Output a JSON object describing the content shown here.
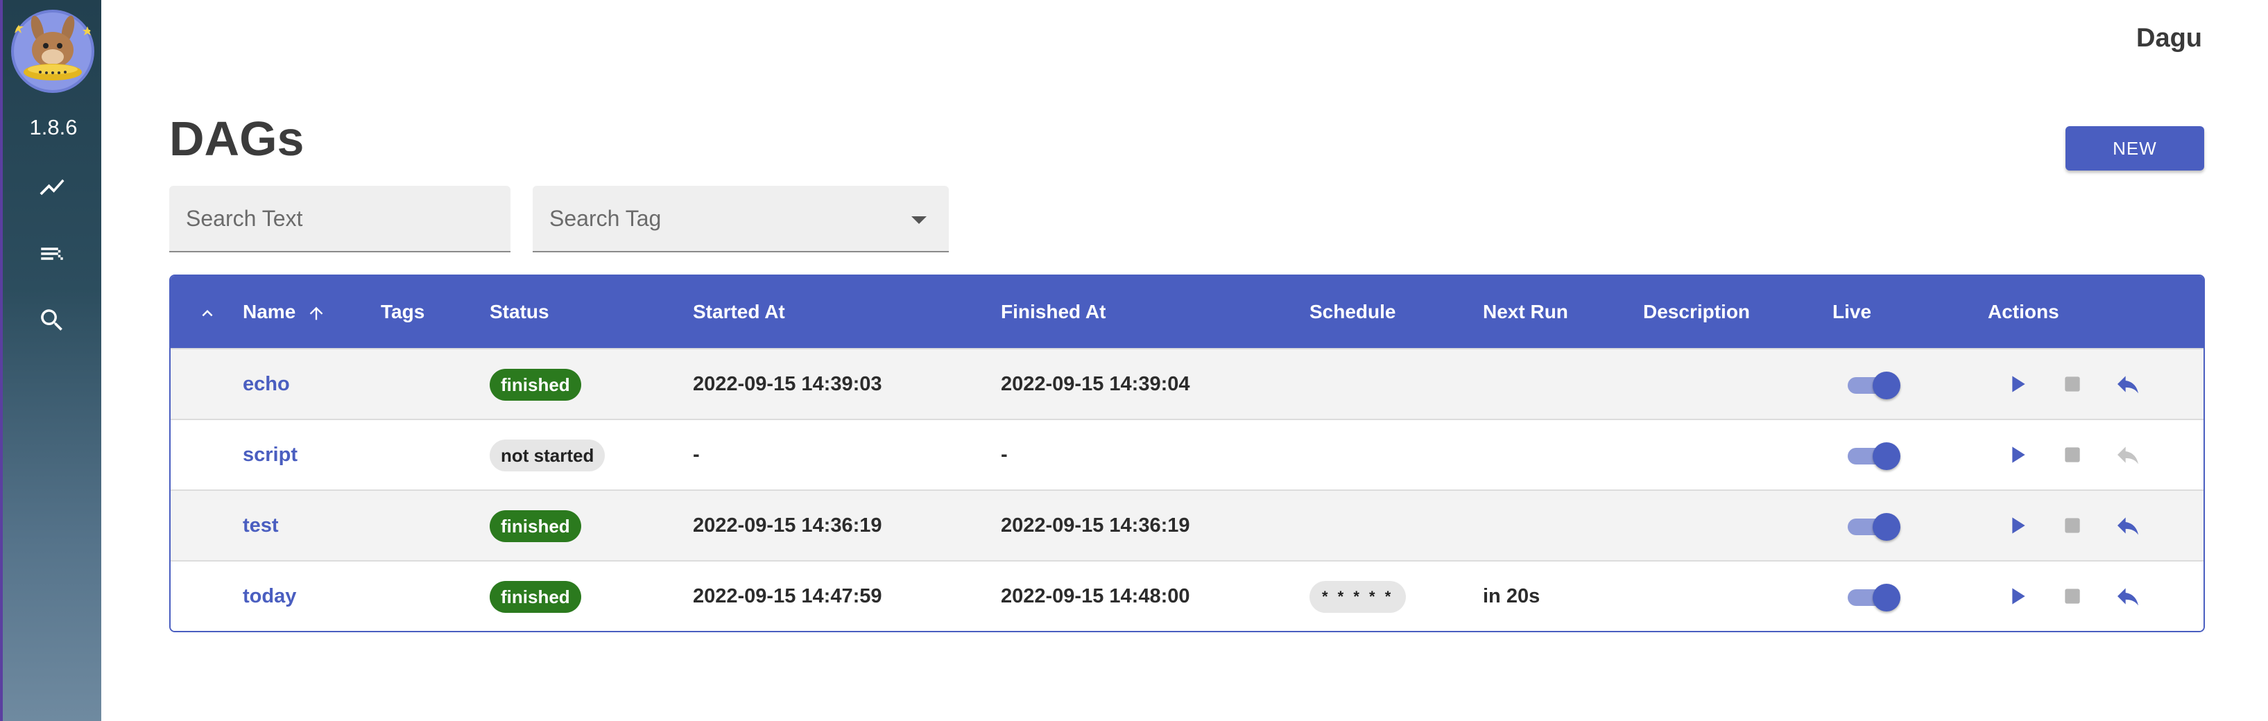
{
  "app": {
    "brand": "Dagu",
    "version": "1.8.6"
  },
  "page": {
    "title": "DAGs",
    "new_button": "NEW"
  },
  "filters": {
    "search_text_placeholder": "Search Text",
    "search_tag_placeholder": "Search Tag"
  },
  "table": {
    "headers": {
      "name": "Name",
      "tags": "Tags",
      "status": "Status",
      "started_at": "Started At",
      "finished_at": "Finished At",
      "schedule": "Schedule",
      "next_run": "Next Run",
      "description": "Description",
      "live": "Live",
      "actions": "Actions"
    },
    "rows": [
      {
        "name": "echo",
        "status": "finished",
        "started_at": "2022-09-15 14:39:03",
        "finished_at": "2022-09-15 14:39:04",
        "schedule": "",
        "next_run": "",
        "live": true,
        "retry_enabled": true
      },
      {
        "name": "script",
        "status": "not started",
        "started_at": "-",
        "finished_at": "-",
        "schedule": "",
        "next_run": "",
        "live": true,
        "retry_enabled": false
      },
      {
        "name": "test",
        "status": "finished",
        "started_at": "2022-09-15 14:36:19",
        "finished_at": "2022-09-15 14:36:19",
        "schedule": "",
        "next_run": "",
        "live": true,
        "retry_enabled": true
      },
      {
        "name": "today",
        "status": "finished",
        "started_at": "2022-09-15 14:47:59",
        "finished_at": "2022-09-15 14:48:00",
        "schedule": "* * * * *",
        "next_run": "in 20s",
        "live": true,
        "retry_enabled": true
      }
    ]
  },
  "colors": {
    "primary": "#4a5ec0",
    "finished": "#2b7a1e",
    "chip_grey": "#e6e6e6",
    "sidebar_top": "#22404f"
  },
  "icons": {
    "nav": [
      "chart-line-icon",
      "list-icon",
      "search-icon"
    ]
  }
}
